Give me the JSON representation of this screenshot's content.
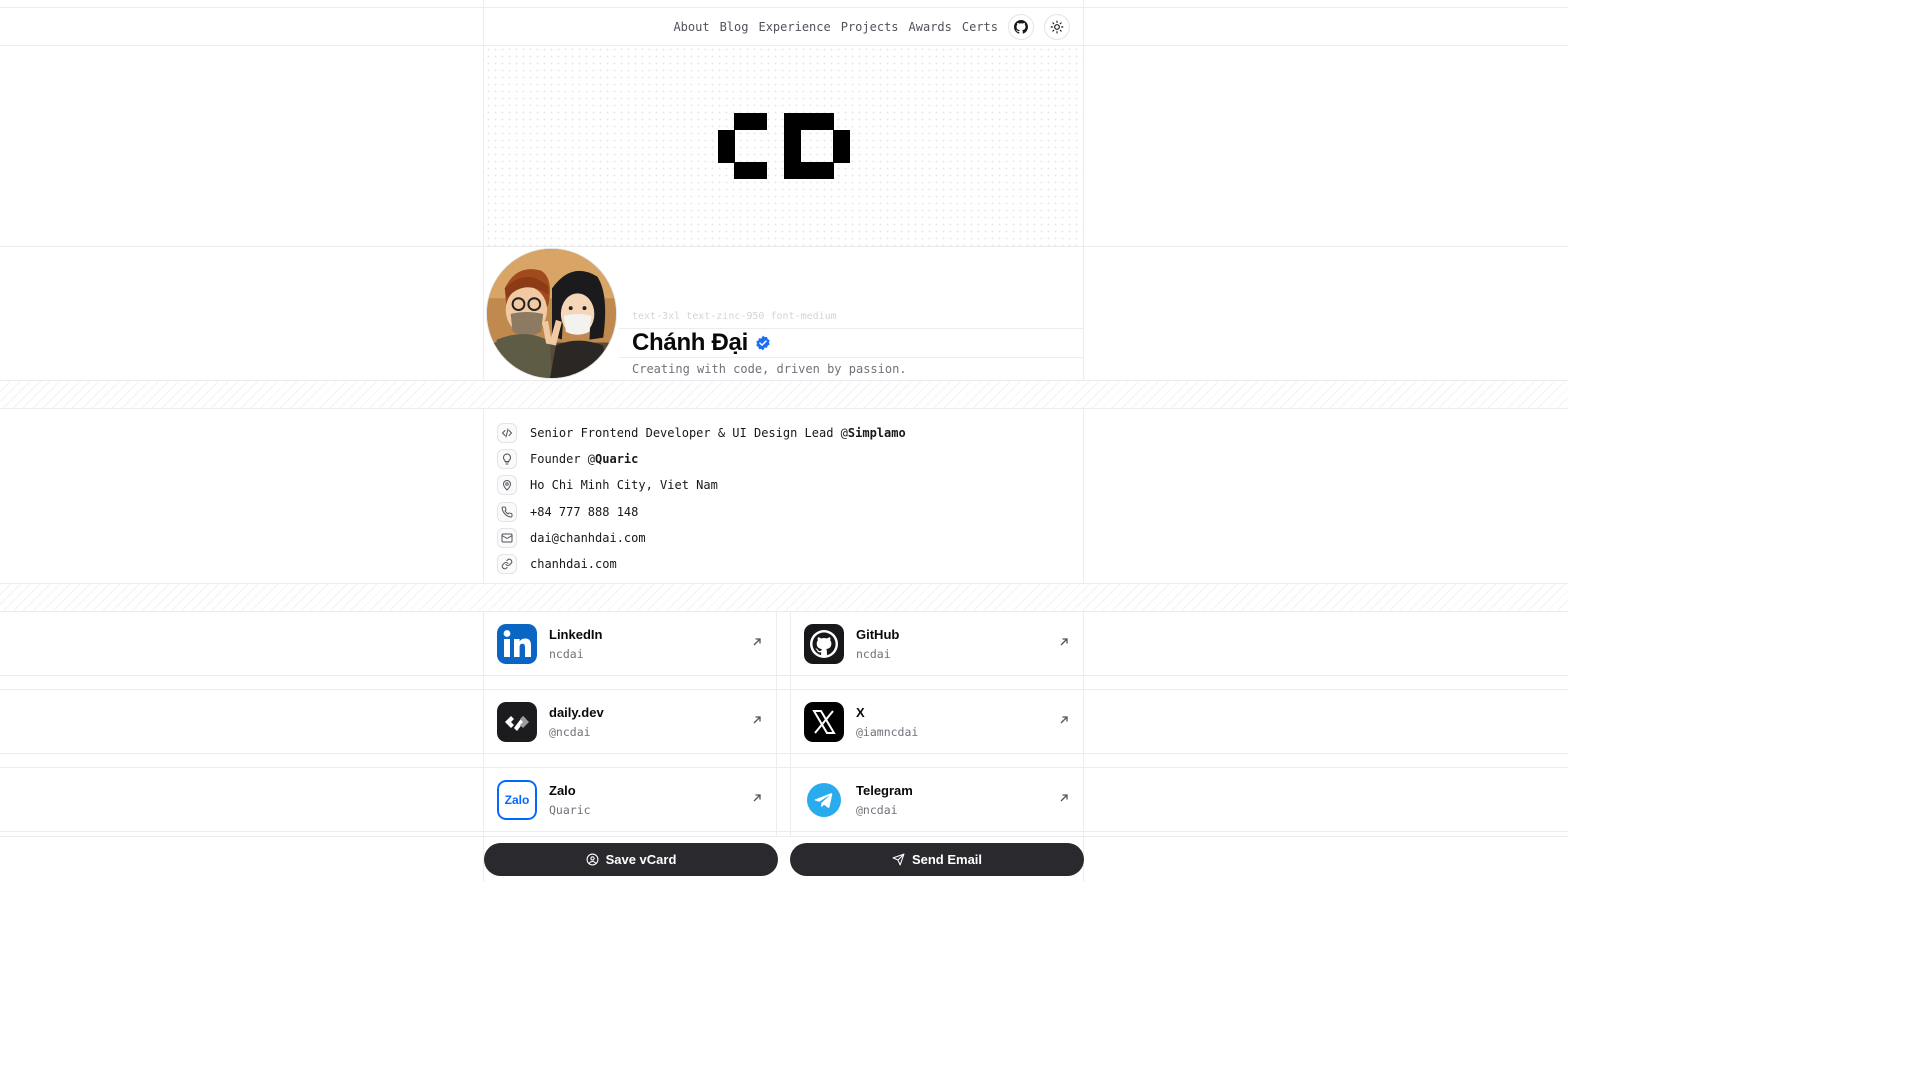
{
  "nav": {
    "links": [
      "About",
      "Blog",
      "Experience",
      "Projects",
      "Awards",
      "Certs"
    ],
    "github_icon": "github-icon",
    "theme_icon": "sun-icon"
  },
  "banner": {
    "logo_icon": "cd-pixel-logo"
  },
  "profile": {
    "hint": "text-3xl text-zinc-950 font-medium",
    "name": "Chánh Đại",
    "verified_icon": "verified-badge-icon",
    "verified_color": "#1d6ef2",
    "tagline": "Creating with code, driven by passion."
  },
  "info": {
    "job_prefix": "Senior Frontend Developer & UI Design Lead @",
    "job_company": "Simplamo",
    "founder_prefix": "Founder @",
    "founder_company": "Quaric",
    "location": "Ho Chi Minh City, Viet Nam",
    "phone": "+84 777 888 148",
    "email": "dai@chanhdai.com",
    "website": "chanhdai.com"
  },
  "social": [
    {
      "title": "LinkedIn",
      "handle": "ncdai",
      "color": "#0a66c2"
    },
    {
      "title": "GitHub",
      "handle": "ncdai",
      "color": "#18181b"
    },
    {
      "title": "daily.dev",
      "handle": "@ncdai",
      "color": "#1c1c1e"
    },
    {
      "title": "X",
      "handle": "@iamncdai",
      "color": "#000000"
    },
    {
      "title": "Zalo",
      "handle": "Quaric",
      "color": "#0068ff"
    },
    {
      "title": "Telegram",
      "handle": "@ncdai",
      "color": "#2aabee"
    }
  ],
  "actions": {
    "save": "Save vCard",
    "email": "Send Email"
  }
}
